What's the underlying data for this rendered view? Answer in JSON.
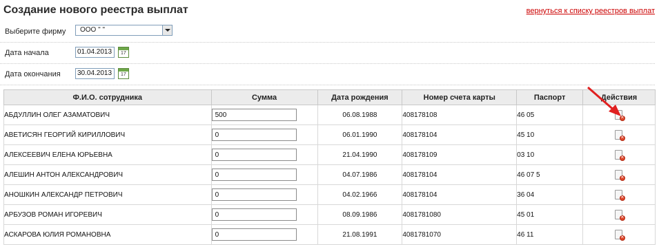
{
  "page": {
    "title": "Создание нового реестра выплат",
    "back_link": "вернуться к списку реестров выплат"
  },
  "form": {
    "firm_label": "Выберите фирму",
    "firm_value": "ООО \"                        \"",
    "start_label": "Дата начала",
    "start_value": "01.04.2013",
    "end_label": "Дата окончания",
    "end_value": "30.04.2013",
    "calendar_day": "17"
  },
  "table": {
    "headers": [
      "Ф.И.О. сотрудника",
      "Сумма",
      "Дата рождения",
      "Номер счета карты",
      "Паспорт",
      "Действия"
    ],
    "rows": [
      {
        "name": "АБДУЛЛИН ОЛЕГ АЗАМАТОВИЧ",
        "sum": "500",
        "dob": "06.08.1988",
        "card": "408178108",
        "passport": "46 05"
      },
      {
        "name": "АВЕТИСЯН ГЕОРГИЙ КИРИЛЛОВИЧ",
        "sum": "0",
        "dob": "06.01.1990",
        "card": "408178104",
        "passport": "45 10"
      },
      {
        "name": "АЛЕКСЕЕВИЧ ЕЛЕНА ЮРЬЕВНА",
        "sum": "0",
        "dob": "21.04.1990",
        "card": "408178109",
        "passport": "03 10"
      },
      {
        "name": "АЛЕШИН АНТОН АЛЕКСАНДРОВИЧ",
        "sum": "0",
        "dob": "04.07.1986",
        "card": "408178104",
        "passport": "46 07 5"
      },
      {
        "name": "АНОШКИН АЛЕКСАНДР ПЕТРОВИЧ",
        "sum": "0",
        "dob": "04.02.1966",
        "card": "408178104",
        "passport": "36 04"
      },
      {
        "name": "АРБУЗОВ РОМАН ИГОРЕВИЧ",
        "sum": "0",
        "dob": "08.09.1986",
        "card": "4081781080",
        "passport": "45 01"
      },
      {
        "name": "АСКАРОВА ЮЛИЯ РОМАНОВНА",
        "sum": "0",
        "dob": "21.08.1991",
        "card": "4081781070",
        "passport": "46 11"
      }
    ]
  },
  "icons": {
    "delete": "delete-document-icon",
    "calendar": "calendar-icon",
    "annotation_arrow": "red-arrow-icon"
  },
  "colors": {
    "link": "#cc0000",
    "header_bg": "#ececec",
    "arrow": "#e02020"
  }
}
